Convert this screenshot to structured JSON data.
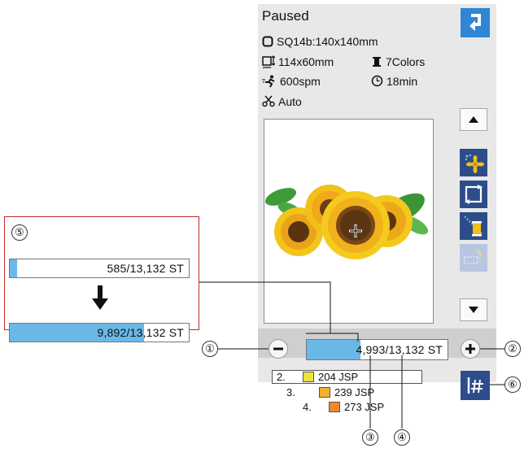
{
  "screen": {
    "status": "Paused",
    "design_name": "SQ14b:140x140mm",
    "size": "114x60mm",
    "colors": "7Colors",
    "speed": "600spm",
    "time": "18min",
    "thread_cut": "Auto"
  },
  "stitch_counter": {
    "value": "4,993/13,132 ST",
    "current": 4993,
    "total": 13132,
    "progress": 0.38
  },
  "color_list": [
    {
      "index": "2.",
      "label": "204 JSP",
      "color": "#ece23e",
      "selected": true
    },
    {
      "index": "3.",
      "label": "239 JSP",
      "color": "#f1b02e",
      "selected": false
    },
    {
      "index": "4.",
      "label": "273 JSP",
      "color": "#f0872c",
      "selected": false
    }
  ],
  "inset": {
    "number": "⑤",
    "before": {
      "value": "585/13,132 ST",
      "progress": 0.04
    },
    "after": {
      "value": "9,892/13,132 ST",
      "progress": 0.75
    }
  },
  "callouts": {
    "c1": "①",
    "c2": "②",
    "c3": "③",
    "c4": "④",
    "c6": "⑥"
  },
  "accent": {
    "blue": "#2e86d4",
    "navy": "#2d4c8a",
    "progress": "#6ab8e6",
    "inset_border": "#c62828"
  },
  "icons": [
    "hoop-icon",
    "size-icon",
    "spool-icon",
    "speed-icon",
    "clock-icon",
    "thread-cut-icon",
    "back-icon",
    "arrow-up-icon",
    "arrow-down-icon",
    "color-change-icon",
    "rotate-icon",
    "trace-icon",
    "disabled-tool-icon",
    "minus-icon",
    "plus-icon",
    "jump-icon",
    "down-arrow-icon"
  ]
}
